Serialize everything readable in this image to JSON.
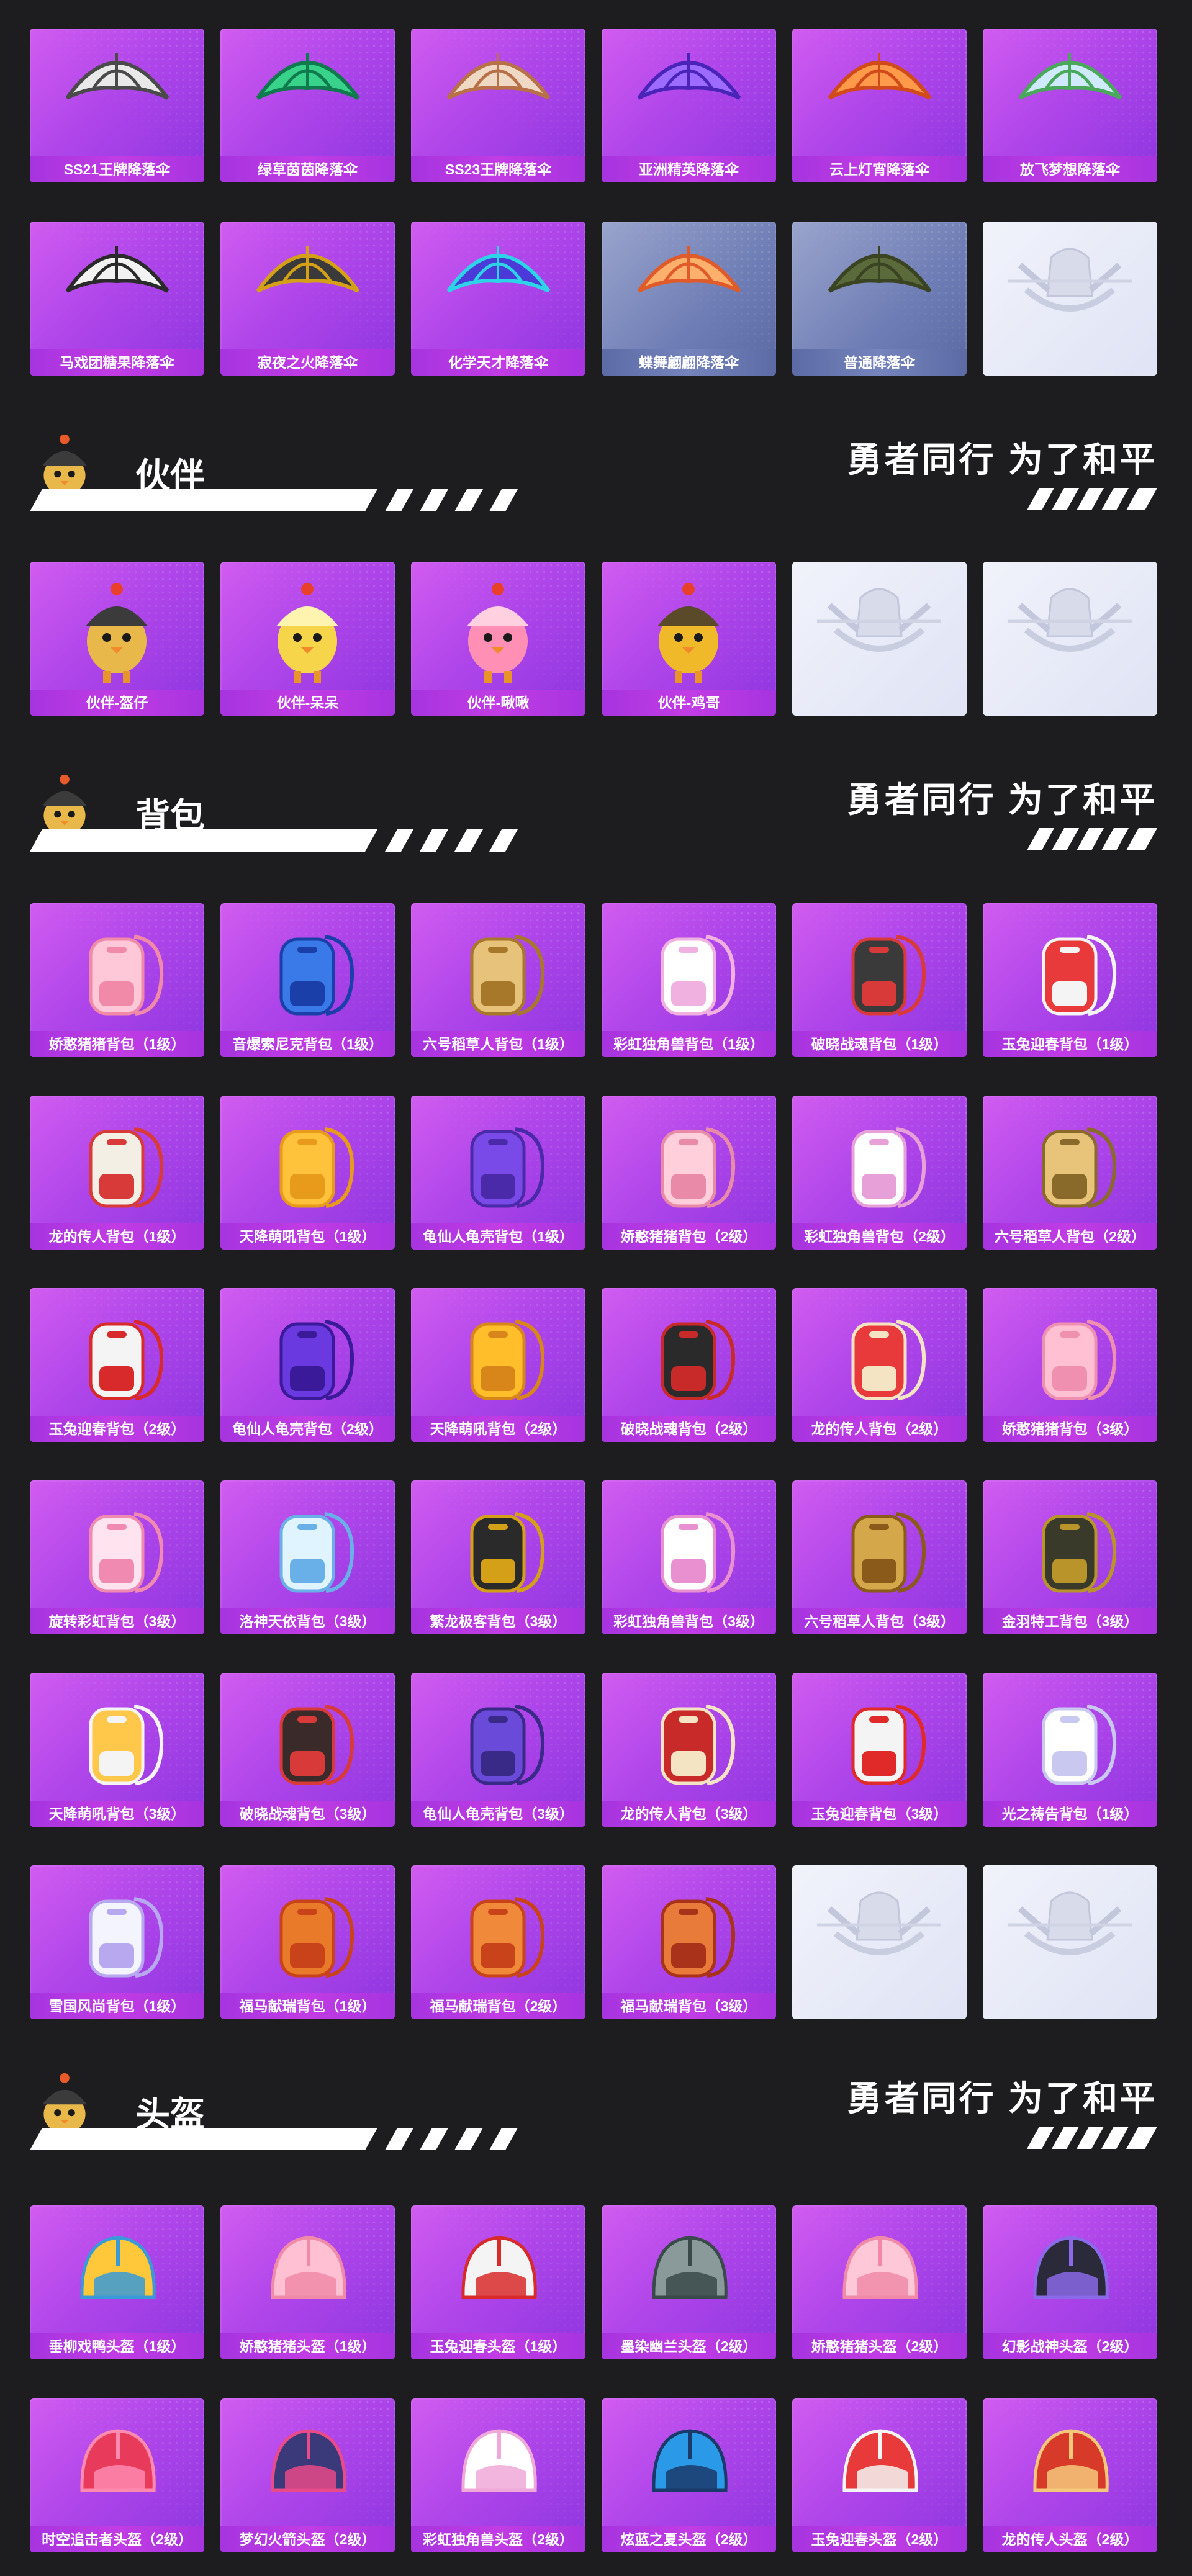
{
  "colors": {
    "background": "#1d1d1f",
    "card_purple": "#b046ea",
    "card_blue": "#6e7db5",
    "label_bar": "#a634df"
  },
  "parachutes": [
    {
      "label": "SS21王牌降落伞",
      "icon": "parachute-icon",
      "variant": "purple",
      "art": {
        "type": "chute",
        "c1": "#e9e9e9",
        "c2": "#4a4a4a"
      }
    },
    {
      "label": "绿草茵茵降落伞",
      "icon": "parachute-icon",
      "variant": "purple",
      "art": {
        "type": "chute",
        "c1": "#39d28a",
        "c2": "#0e7a4d"
      }
    },
    {
      "label": "SS23王牌降落伞",
      "icon": "parachute-icon",
      "variant": "purple",
      "art": {
        "type": "chute",
        "c1": "#f0d9c4",
        "c2": "#b87048"
      }
    },
    {
      "label": "亚洲精英降落伞",
      "icon": "parachute-icon",
      "variant": "purple",
      "art": {
        "type": "chute",
        "c1": "#9d6bff",
        "c2": "#4a24b8"
      }
    },
    {
      "label": "云上灯宵降落伞",
      "icon": "parachute-icon",
      "variant": "purple",
      "art": {
        "type": "chute",
        "c1": "#ff9a4a",
        "c2": "#d14a1a"
      }
    },
    {
      "label": "放飞梦想降落伞",
      "icon": "parachute-icon",
      "variant": "purple",
      "art": {
        "type": "chute",
        "c1": "#cfe9ff",
        "c2": "#4aa85a"
      }
    },
    {
      "label": "马戏团糖果降落伞",
      "icon": "parachute-icon",
      "variant": "purple",
      "art": {
        "type": "chute",
        "c1": "#f2f2f2",
        "c2": "#2a2a2a"
      }
    },
    {
      "label": "寂夜之火降落伞",
      "icon": "parachute-icon",
      "variant": "purple",
      "art": {
        "type": "chute",
        "c1": "#3a3a3a",
        "c2": "#d4a017"
      }
    },
    {
      "label": "化学天才降落伞",
      "icon": "parachute-icon",
      "variant": "purple",
      "art": {
        "type": "chute",
        "c1": "#4b3ad8",
        "c2": "#2dd4e8"
      }
    },
    {
      "label": "蝶舞翩翩降落伞",
      "icon": "parachute-icon",
      "variant": "blue",
      "art": {
        "type": "chute",
        "c1": "#ffb06a",
        "c2": "#e05a2a"
      }
    },
    {
      "label": "普通降落伞",
      "icon": "parachute-icon",
      "variant": "blue",
      "art": {
        "type": "chute",
        "c1": "#5a6a3a",
        "c2": "#3a4422"
      }
    },
    {
      "label": "",
      "icon": "emblem-placeholder-icon",
      "variant": "empty",
      "art": {
        "type": "emblem"
      }
    }
  ],
  "sections": [
    {
      "title": "伙伴",
      "slogan": "勇者同行 为了和平"
    },
    {
      "title": "背包",
      "slogan": "勇者同行 为了和平"
    },
    {
      "title": "头盔",
      "slogan": "勇者同行 为了和平"
    }
  ],
  "companions": [
    {
      "label": "伙伴-盔仔",
      "icon": "helmet-chick-icon",
      "variant": "purple",
      "art": {
        "type": "chick",
        "c1": "#3b3b3b",
        "c2": "#e8b94a"
      }
    },
    {
      "label": "伙伴-呆呆",
      "icon": "chick-icon",
      "variant": "purple",
      "art": {
        "type": "chick",
        "c1": "#fff3b0",
        "c2": "#f7d54a"
      }
    },
    {
      "label": "伙伴-啾啾",
      "icon": "pink-bird-icon",
      "variant": "purple",
      "art": {
        "type": "chick",
        "c1": "#ffd0e0",
        "c2": "#ff8fb5"
      }
    },
    {
      "label": "伙伴-鸡哥",
      "icon": "rooster-icon",
      "variant": "purple",
      "art": {
        "type": "chick",
        "c1": "#5a4a2a",
        "c2": "#f0b92a"
      }
    },
    {
      "label": "",
      "icon": "emblem-placeholder-icon",
      "variant": "empty",
      "art": {
        "type": "emblem"
      }
    },
    {
      "label": "",
      "icon": "emblem-placeholder-icon",
      "variant": "empty",
      "art": {
        "type": "emblem"
      }
    }
  ],
  "backpacks": [
    {
      "label": "娇憨猪猪背包（1级）",
      "icon": "backpack-icon",
      "variant": "purple",
      "art": {
        "type": "pack",
        "c1": "#ffc8d8",
        "c2": "#f08aa8"
      }
    },
    {
      "label": "音爆索尼克背包（1级）",
      "icon": "backpack-icon",
      "variant": "purple",
      "art": {
        "type": "pack",
        "c1": "#3a7ae8",
        "c2": "#1a3fa8"
      }
    },
    {
      "label": "六号稻草人背包（1级）",
      "icon": "backpack-icon",
      "variant": "purple",
      "art": {
        "type": "pack",
        "c1": "#e6c27a",
        "c2": "#a8782a"
      }
    },
    {
      "label": "彩虹独角兽背包（1级）",
      "icon": "backpack-icon",
      "variant": "purple",
      "art": {
        "type": "pack",
        "c1": "#ffffff",
        "c2": "#f0b0e0"
      }
    },
    {
      "label": "破晓战魂背包（1级）",
      "icon": "backpack-icon",
      "variant": "purple",
      "art": {
        "type": "pack",
        "c1": "#3a3a3a",
        "c2": "#d83a3a"
      }
    },
    {
      "label": "玉兔迎春背包（1级）",
      "icon": "backpack-icon",
      "variant": "purple",
      "art": {
        "type": "pack",
        "c1": "#e83a3a",
        "c2": "#f4f4f4"
      }
    },
    {
      "label": "龙的传人背包（1级）",
      "icon": "backpack-icon",
      "variant": "purple",
      "art": {
        "type": "pack",
        "c1": "#f4efe4",
        "c2": "#d83a3a"
      }
    },
    {
      "label": "天降萌吼背包（1级）",
      "icon": "backpack-icon",
      "variant": "purple",
      "art": {
        "type": "pack",
        "c1": "#ffc23a",
        "c2": "#e89a1a"
      }
    },
    {
      "label": "龟仙人龟壳背包（1级）",
      "icon": "backpack-icon",
      "variant": "purple",
      "art": {
        "type": "pack",
        "c1": "#7a4ae8",
        "c2": "#4a2aa8"
      }
    },
    {
      "label": "娇憨猪猪背包（2级）",
      "icon": "backpack-icon",
      "variant": "purple",
      "art": {
        "type": "pack",
        "c1": "#ffd0dc",
        "c2": "#e88aa8"
      }
    },
    {
      "label": "彩虹独角兽背包（2级）",
      "icon": "backpack-icon",
      "variant": "purple",
      "art": {
        "type": "pack",
        "c1": "#ffffff",
        "c2": "#e8a0d8"
      }
    },
    {
      "label": "六号稻草人背包（2级）",
      "icon": "backpack-icon",
      "variant": "purple",
      "art": {
        "type": "pack",
        "c1": "#e8c47a",
        "c2": "#8a6a2a"
      }
    },
    {
      "label": "玉兔迎春背包（2级）",
      "icon": "backpack-icon",
      "variant": "purple",
      "art": {
        "type": "pack",
        "c1": "#f4f4f4",
        "c2": "#d82a2a"
      }
    },
    {
      "label": "龟仙人龟壳背包（2级）",
      "icon": "backpack-icon",
      "variant": "purple",
      "art": {
        "type": "pack",
        "c1": "#6a3ae0",
        "c2": "#3a1a98"
      }
    },
    {
      "label": "天降萌吼背包（2级）",
      "icon": "backpack-icon",
      "variant": "purple",
      "art": {
        "type": "pack",
        "c1": "#ffbe2a",
        "c2": "#d8861a"
      }
    },
    {
      "label": "破晓战魂背包（2级）",
      "icon": "backpack-icon",
      "variant": "purple",
      "art": {
        "type": "pack",
        "c1": "#2a2a2a",
        "c2": "#c82a2a"
      }
    },
    {
      "label": "龙的传人背包（2级）",
      "icon": "backpack-icon",
      "variant": "purple",
      "art": {
        "type": "pack",
        "c1": "#e83a3a",
        "c2": "#f4e4c4"
      }
    },
    {
      "label": "娇憨猪猪背包（3级）",
      "icon": "backpack-icon",
      "variant": "purple",
      "art": {
        "type": "pack",
        "c1": "#ffc0d4",
        "c2": "#f090b0"
      }
    },
    {
      "label": "旋转彩虹背包（3级）",
      "icon": "backpack-icon",
      "variant": "purple",
      "art": {
        "type": "pack",
        "c1": "#ffe4f0",
        "c2": "#f08ab0"
      }
    },
    {
      "label": "洛神天依背包（3级）",
      "icon": "backpack-icon",
      "variant": "purple",
      "art": {
        "type": "pack",
        "c1": "#e0f4ff",
        "c2": "#6ab0e8"
      }
    },
    {
      "label": "繁龙极客背包（3级）",
      "icon": "backpack-icon",
      "variant": "purple",
      "art": {
        "type": "pack",
        "c1": "#2a2a2a",
        "c2": "#d4a017"
      }
    },
    {
      "label": "彩虹独角兽背包（3级）",
      "icon": "backpack-icon",
      "variant": "purple",
      "art": {
        "type": "pack",
        "c1": "#ffffff",
        "c2": "#e890d0"
      }
    },
    {
      "label": "六号稻草人背包（3级）",
      "icon": "backpack-icon",
      "variant": "purple",
      "art": {
        "type": "pack",
        "c1": "#d4a84a",
        "c2": "#8a5a1a"
      }
    },
    {
      "label": "金羽特工背包（3级）",
      "icon": "backpack-icon",
      "variant": "purple",
      "art": {
        "type": "pack",
        "c1": "#3a3a2a",
        "c2": "#b8942a"
      }
    },
    {
      "label": "天降萌吼背包（3级）",
      "icon": "backpack-icon",
      "variant": "purple",
      "art": {
        "type": "pack",
        "c1": "#ffc84a",
        "c2": "#f4f4f4"
      }
    },
    {
      "label": "破晓战魂背包（3级）",
      "icon": "backpack-icon",
      "variant": "purple",
      "art": {
        "type": "pack",
        "c1": "#3a2a2a",
        "c2": "#d83a3a"
      }
    },
    {
      "label": "龟仙人龟壳背包（3级）",
      "icon": "backpack-icon",
      "variant": "purple",
      "art": {
        "type": "pack",
        "c1": "#6a4ad8",
        "c2": "#3a2a88"
      }
    },
    {
      "label": "龙的传人背包（3级）",
      "icon": "backpack-icon",
      "variant": "purple",
      "art": {
        "type": "pack",
        "c1": "#c82a2a",
        "c2": "#f4e4c4"
      }
    },
    {
      "label": "玉兔迎春背包（3级）",
      "icon": "backpack-icon",
      "variant": "purple",
      "art": {
        "type": "pack",
        "c1": "#f4f4f4",
        "c2": "#e02a2a"
      }
    },
    {
      "label": "光之祷告背包（1级）",
      "icon": "backpack-icon",
      "variant": "purple",
      "art": {
        "type": "pack",
        "c1": "#ffffff",
        "c2": "#c8c8f0"
      }
    },
    {
      "label": "雪国风尚背包（1级）",
      "icon": "backpack-icon",
      "variant": "purple",
      "art": {
        "type": "pack",
        "c1": "#f4f4ff",
        "c2": "#b8a8f0"
      }
    },
    {
      "label": "福马献瑞背包（1级）",
      "icon": "backpack-icon",
      "variant": "purple",
      "art": {
        "type": "pack",
        "c1": "#e87a2a",
        "c2": "#c8421a"
      }
    },
    {
      "label": "福马献瑞背包（2级）",
      "icon": "backpack-icon",
      "variant": "purple",
      "art": {
        "type": "pack",
        "c1": "#f08a3a",
        "c2": "#c8421a"
      }
    },
    {
      "label": "福马献瑞背包（3级）",
      "icon": "backpack-icon",
      "variant": "purple",
      "art": {
        "type": "pack",
        "c1": "#e87a3a",
        "c2": "#a8321a"
      }
    },
    {
      "label": "",
      "icon": "emblem-placeholder-icon",
      "variant": "empty",
      "art": {
        "type": "emblem"
      }
    },
    {
      "label": "",
      "icon": "emblem-placeholder-icon",
      "variant": "empty",
      "art": {
        "type": "emblem"
      }
    }
  ],
  "helmets": [
    {
      "label": "垂柳戏鸭头盔（1级）",
      "icon": "helmet-icon",
      "variant": "purple",
      "art": {
        "type": "helmet",
        "c1": "#ffc83a",
        "c2": "#3a9ad8"
      }
    },
    {
      "label": "娇憨猪猪头盔（1级）",
      "icon": "helmet-icon",
      "variant": "purple",
      "art": {
        "type": "helmet",
        "c1": "#ffc0d4",
        "c2": "#f08aa8"
      }
    },
    {
      "label": "玉兔迎春头盔（1级）",
      "icon": "helmet-icon",
      "variant": "purple",
      "art": {
        "type": "helmet",
        "c1": "#f4f4f4",
        "c2": "#d82a2a"
      }
    },
    {
      "label": "墨染幽兰头盔（2级）",
      "icon": "helmet-icon",
      "variant": "purple",
      "art": {
        "type": "helmet",
        "c1": "#8a9a9a",
        "c2": "#3a4a4a"
      }
    },
    {
      "label": "娇憨猪猪头盔（2级）",
      "icon": "helmet-icon",
      "variant": "purple",
      "art": {
        "type": "helmet",
        "c1": "#ffc8d8",
        "c2": "#f08aa8"
      }
    },
    {
      "label": "幻影战神头盔（2级）",
      "icon": "helmet-icon",
      "variant": "purple",
      "art": {
        "type": "helmet",
        "c1": "#2a2a3a",
        "c2": "#8a6ae8"
      }
    },
    {
      "label": "时空追击者头盔（2级）",
      "icon": "helmet-icon",
      "variant": "purple",
      "art": {
        "type": "helmet",
        "c1": "#e83a5a",
        "c2": "#ff8ab0"
      }
    },
    {
      "label": "梦幻火箭头盔（2级）",
      "icon": "helmet-icon",
      "variant": "purple",
      "art": {
        "type": "helmet",
        "c1": "#3a3a7a",
        "c2": "#e84a8a"
      }
    },
    {
      "label": "彩虹独角兽头盔（2级）",
      "icon": "helmet-icon",
      "variant": "purple",
      "art": {
        "type": "helmet",
        "c1": "#ffffff",
        "c2": "#f0a8d8"
      }
    },
    {
      "label": "炫蓝之夏头盔（2级）",
      "icon": "helmet-icon",
      "variant": "purple",
      "art": {
        "type": "helmet",
        "c1": "#2a9ae8",
        "c2": "#1a3a6a"
      }
    },
    {
      "label": "玉兔迎春头盔（2级）",
      "icon": "helmet-icon",
      "variant": "purple",
      "art": {
        "type": "helmet",
        "c1": "#e83a3a",
        "c2": "#f4f4f4"
      }
    },
    {
      "label": "龙的传人头盔（2级）",
      "icon": "helmet-icon",
      "variant": "purple",
      "art": {
        "type": "helmet",
        "c1": "#d83a2a",
        "c2": "#f4c87a"
      }
    }
  ]
}
